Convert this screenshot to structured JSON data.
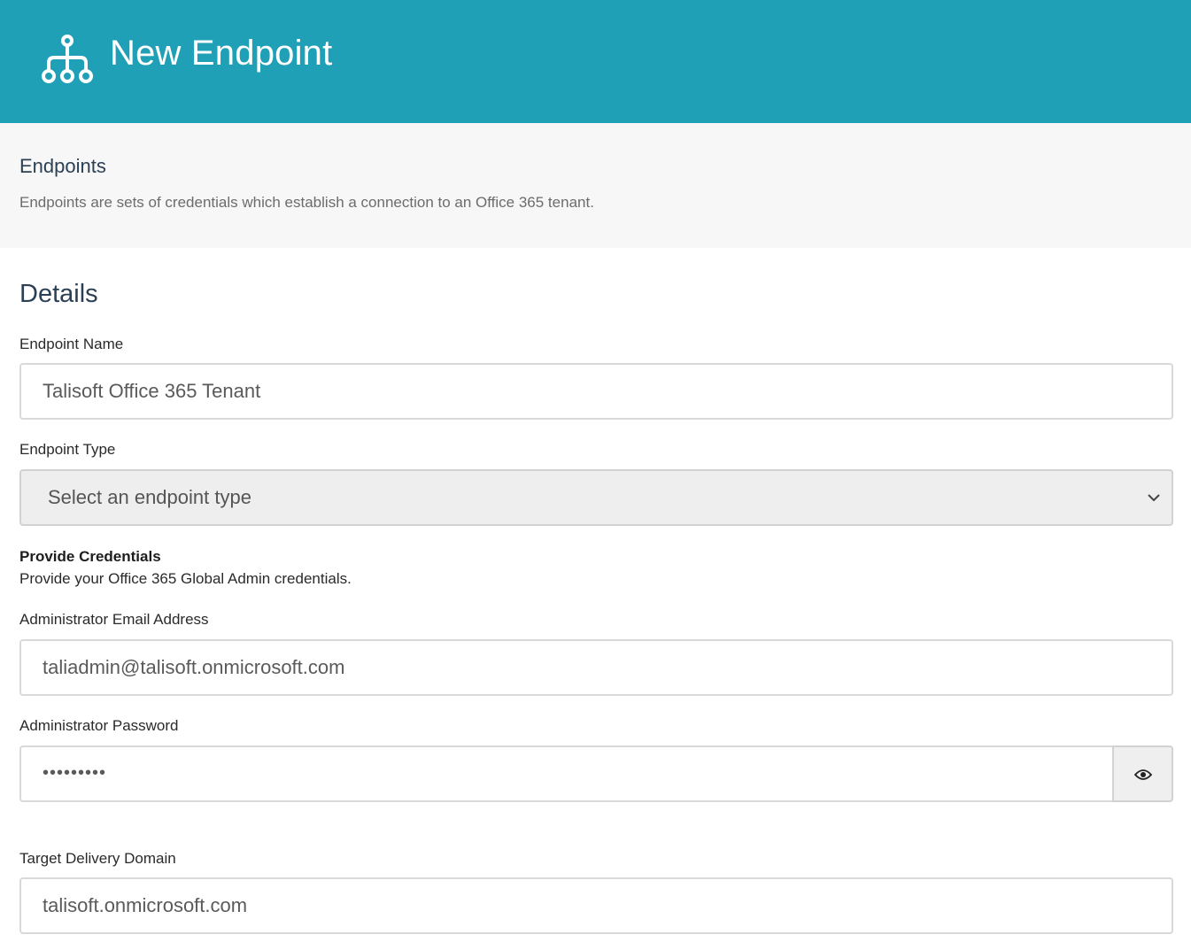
{
  "header": {
    "title": "New Endpoint",
    "icon": "network-tree-icon",
    "background_color": "#20a0b6"
  },
  "intro": {
    "title": "Endpoints",
    "description": "Endpoints are sets of credentials which establish a connection to an Office 365 tenant."
  },
  "details": {
    "section_title": "Details",
    "endpoint_name": {
      "label": "Endpoint Name",
      "value": "Talisoft Office 365 Tenant"
    },
    "endpoint_type": {
      "label": "Endpoint Type",
      "selected": "Select an endpoint type"
    },
    "credentials": {
      "title": "Provide Credentials",
      "description": "Provide your Office 365 Global Admin credentials."
    },
    "admin_email": {
      "label": "Administrator Email Address",
      "value": "taliadmin@talisoft.onmicrosoft.com"
    },
    "admin_password": {
      "label": "Administrator Password",
      "masked_value": "•••••••••",
      "toggle_icon": "eye-icon"
    },
    "target_domain": {
      "label": "Target Delivery Domain",
      "value": "talisoft.onmicrosoft.com"
    }
  }
}
